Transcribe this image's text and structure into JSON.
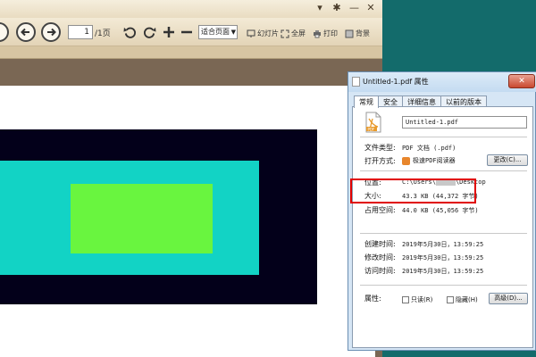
{
  "viewer": {
    "page_current": "1",
    "page_total": "/1页",
    "zoom": "适合页面",
    "btn_slide": "幻灯片",
    "btn_fullscreen": "全屏",
    "btn_print": "打印",
    "btn_bg": "背景",
    "icons": [
      "back-arrow-icon",
      "forward-arrow-icon",
      "rotate-ccw-icon",
      "rotate-cw-icon",
      "zoom-in-icon",
      "zoom-out-icon"
    ],
    "colors": {
      "black_rect": "#03001a",
      "cyan_rect": "#12d3c5",
      "green_rect": "#69f53f"
    }
  },
  "dialog": {
    "title": "Untitled-1.pdf 属性",
    "close": "✕",
    "tabs": [
      "常规",
      "安全",
      "详细信息",
      "以前的版本"
    ],
    "filename": "Untitled-1.pdf",
    "rows": {
      "type_label": "文件类型:",
      "type_value": "PDF 文档 (.pdf)",
      "open_label": "打开方式:",
      "open_value": "极速PDF阅读器",
      "change_btn": "更改(C)...",
      "location_label": "位置:",
      "location_prefix": "C:\\Users\\",
      "location_suffix": "\\Desktop",
      "size_label": "大小:",
      "size_value": "43.3 KB (44,372 字节)",
      "disk_label": "占用空间:",
      "disk_value": "44.0 KB (45,056 字节)",
      "created_label": "创建时间:",
      "created_value": "2019年5月30日，13:59:25",
      "modified_label": "修改时间:",
      "modified_value": "2019年5月30日，13:59:25",
      "accessed_label": "访问时间:",
      "accessed_value": "2019年5月30日，13:59:25",
      "attr_label": "属性:",
      "readonly": "只读(R)",
      "hidden": "隐藏(H)",
      "advanced_btn": "高级(D)..."
    }
  }
}
